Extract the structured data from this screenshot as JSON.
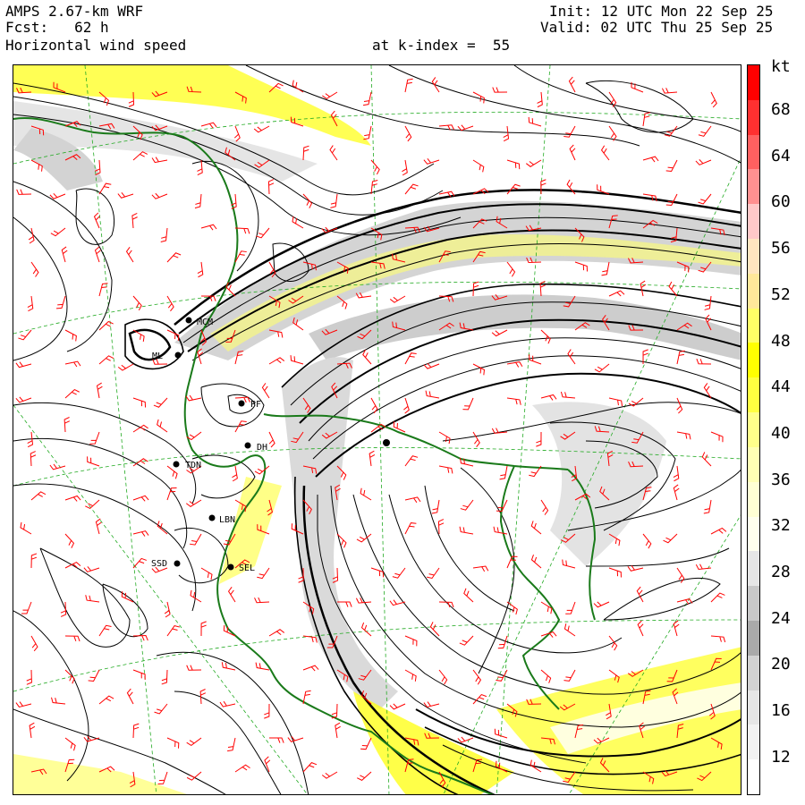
{
  "header": {
    "model": "AMPS 2.67-km WRF",
    "fcst_label": "Fcst:",
    "fcst_value": "62 h",
    "field": "Horizontal wind speed",
    "level": "at k-index =  55",
    "init": "Init: 12 UTC Mon 22 Sep 25",
    "valid": "Valid: 02 UTC Thu 25 Sep 25"
  },
  "colorbar": {
    "unit": "kt",
    "labels": [
      "68",
      "64",
      "60",
      "56",
      "52",
      "48",
      "44",
      "40",
      "36",
      "32",
      "28",
      "24",
      "20",
      "16",
      "12"
    ],
    "colors": [
      "#ff0000",
      "#ff3030",
      "#ff6060",
      "#ff9090",
      "#ffc8c8",
      "#ffe6c0",
      "#ffe89a",
      "#ffff66",
      "#ffff00",
      "#ffff40",
      "#ffff8a",
      "#ffffb4",
      "#ffffd4",
      "#ffffee",
      "#e6e6e6",
      "#c8c8c8",
      "#aaaaaa",
      "#d2d2d2",
      "#e6e6e6",
      "#f2f2f2",
      "#ffffff"
    ]
  },
  "stations": [
    {
      "id": "st-mcm",
      "label": "MCM"
    },
    {
      "id": "st-ml",
      "label": "ML"
    },
    {
      "id": "st-pf",
      "label": "PF"
    },
    {
      "id": "st-dh",
      "label": "DH"
    },
    {
      "id": "st-tdn",
      "label": "TDN"
    },
    {
      "id": "st-lbn",
      "label": "LBN"
    },
    {
      "id": "st-ssd",
      "label": "SSD"
    },
    {
      "id": "st-sel",
      "label": "SEL"
    }
  ],
  "map": {
    "coast_color": "#1a7a1a",
    "grid_color": "#22aa22",
    "barb_color": "#ff0000",
    "streamline_color": "#000000",
    "shade_light": "#dcdcdc",
    "shade_mid": "#c0c0c0",
    "shade_yellow": "#ffff00"
  }
}
